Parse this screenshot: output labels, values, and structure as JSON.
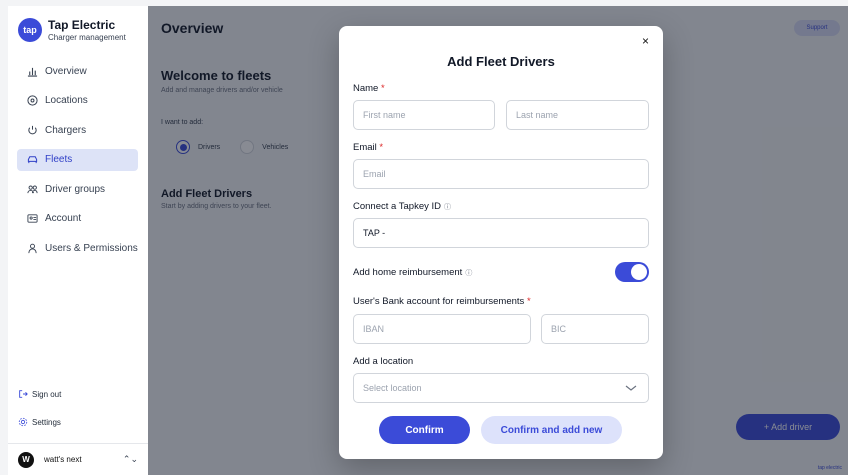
{
  "brand": {
    "logo_text": "tap",
    "title": "Tap Electric",
    "subtitle": "Charger management"
  },
  "sidebar": {
    "items": [
      {
        "label": "Overview",
        "icon": "bar-chart-icon"
      },
      {
        "label": "Locations",
        "icon": "location-pin-icon"
      },
      {
        "label": "Chargers",
        "icon": "charger-icon"
      },
      {
        "label": "Fleets",
        "icon": "car-icon",
        "active": true
      },
      {
        "label": "Driver groups",
        "icon": "users-icon"
      },
      {
        "label": "Account",
        "icon": "id-card-icon"
      },
      {
        "label": "Users & Permissions",
        "icon": "user-icon"
      }
    ],
    "sign_out": "Sign out",
    "settings": "Settings",
    "account_name": "watt's next",
    "account_avatar": "W"
  },
  "main": {
    "title": "Overview",
    "support": "Support",
    "welcome_title": "Welcome to fleets",
    "welcome_sub": "Add and manage drivers and/or vehicle",
    "want_label": "I want to add:",
    "radio_drivers": "Drivers",
    "radio_vehicles": "Vehicles",
    "add_fleet_title": "Add Fleet Drivers",
    "add_fleet_sub": "Start by adding drivers to your fleet.",
    "add_driver_button": "+ Add driver",
    "footer": "tap electric"
  },
  "modal": {
    "title": "Add Fleet Drivers",
    "close": "×",
    "name_label": "Name",
    "first_name_placeholder": "First name",
    "last_name_placeholder": "Last name",
    "email_label": "Email",
    "email_placeholder": "Email",
    "tapkey_label": "Connect a Tapkey ID",
    "tapkey_value": "TAP -",
    "home_reimbursement_label": "Add home reimbursement",
    "home_reimbursement_enabled": true,
    "bank_label": "User's Bank account for reimbursements",
    "iban_placeholder": "IBAN",
    "bic_placeholder": "BIC",
    "location_label": "Add a location",
    "location_placeholder": "Select location",
    "confirm": "Confirm",
    "confirm_and_add_new": "Confirm and add new",
    "required_mark": "*",
    "info_glyph": "ⓘ"
  },
  "colors": {
    "accent": "#3b4bd8",
    "required": "#dc2626"
  }
}
